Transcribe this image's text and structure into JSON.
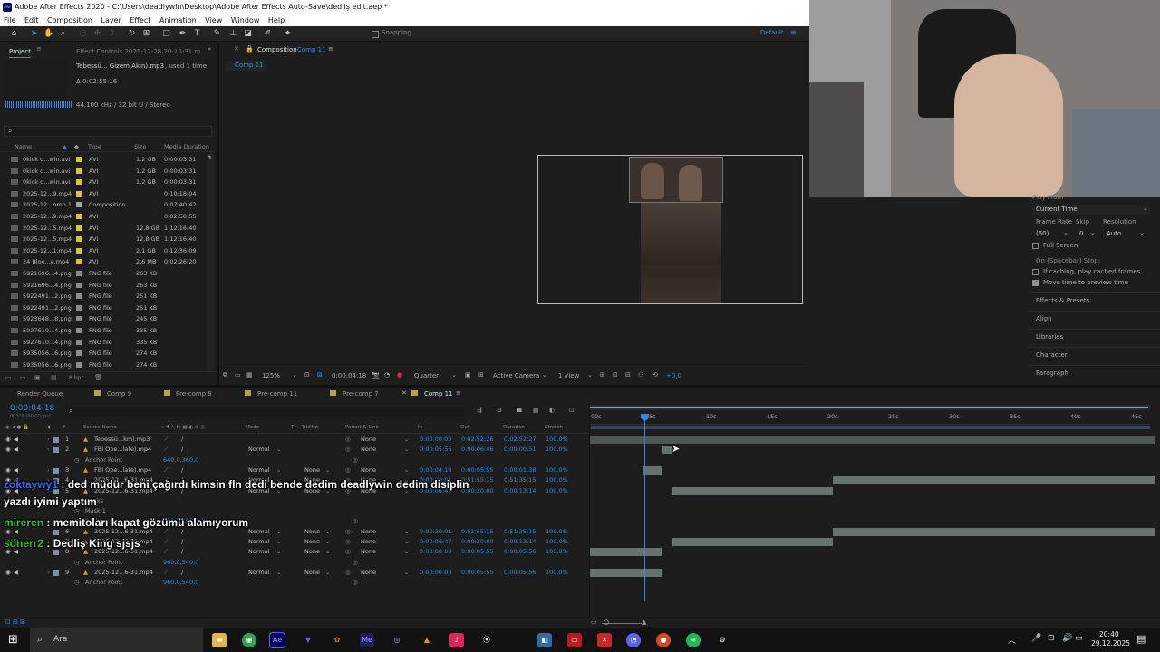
{
  "window": {
    "title": "Adobe After Effects 2020 - C:\\Users\\deadlywin\\Desktop\\Adobe After Effects Auto-Save\\dedliş edit.aep *",
    "logo": "Ae"
  },
  "menu": [
    "File",
    "Edit",
    "Composition",
    "Layer",
    "Effect",
    "Animation",
    "View",
    "Window",
    "Help"
  ],
  "toolbar": {
    "snapping": "Snapping",
    "workspace": "Default"
  },
  "project": {
    "tab": "Project",
    "effect_controls_tab": "Effect Controls 2025-12-28 20-16-31.m",
    "selected_name": "Tebessü... Gizem Akın).mp3",
    "used": ", used 1 time",
    "duration": "Δ 0:02:55:16",
    "audio_info": "44,100 kHz / 32 bit U / Stereo",
    "columns": {
      "name": "Name",
      "type": "Type",
      "size": "Size",
      "duration": "Media Duration"
    },
    "items": [
      {
        "name": "0kick d...win.avi",
        "type": "AVI",
        "size": "1,2 GB",
        "duration": "0:00:03:31",
        "color": "#d7c63a"
      },
      {
        "name": "0kick d...win.avi",
        "type": "AVI",
        "size": "1,2 GB",
        "duration": "0:00:03:31",
        "color": "#d7c63a"
      },
      {
        "name": "0kick d...win.avi",
        "type": "AVI",
        "size": "1,2 GB",
        "duration": "0:00:03:31",
        "color": "#d7c63a"
      },
      {
        "name": "2025-12...9.mp4",
        "type": "AVI",
        "size": "",
        "duration": "0:10:18:04",
        "color": "#d7c63a"
      },
      {
        "name": "2025-12...omp 1",
        "type": "Composition",
        "size": "",
        "duration": "0:07:40:42",
        "color": "#a3a3a3"
      },
      {
        "name": "2025-12...9.mp4",
        "type": "AVI",
        "size": "",
        "duration": "0:02:58:55",
        "color": "#d7c63a"
      },
      {
        "name": "2025-12...5.mp4",
        "type": "AVI",
        "size": "12,8 GB",
        "duration": "1:12:16:40",
        "color": "#d7c63a"
      },
      {
        "name": "2025-12...5.mp4",
        "type": "AVI",
        "size": "12,8 GB",
        "duration": "1:12:16:40",
        "color": "#d7c63a"
      },
      {
        "name": "2025-12...1.mp4",
        "type": "AVI",
        "size": "2,1 GB",
        "duration": "0:12:36:09",
        "color": "#d7c63a"
      },
      {
        "name": "24 Bloo...e.mp4",
        "type": "AVI",
        "size": "2,6 MB",
        "duration": "0:02:26:20",
        "color": "#d7c63a"
      },
      {
        "name": "5921696...4.png",
        "type": "PNG file",
        "size": "263 KB",
        "duration": "",
        "color": "#8c8c8c"
      },
      {
        "name": "5921696...4.png",
        "type": "PNG file",
        "size": "263 KB",
        "duration": "",
        "color": "#8c8c8c"
      },
      {
        "name": "5922491...2.png",
        "type": "PNG file",
        "size": "251 KB",
        "duration": "",
        "color": "#8c8c8c"
      },
      {
        "name": "5922491...2.png",
        "type": "PNG file",
        "size": "251 KB",
        "duration": "",
        "color": "#8c8c8c"
      },
      {
        "name": "5923648...8.png",
        "type": "PNG file",
        "size": "245 KB",
        "duration": "",
        "color": "#8c8c8c"
      },
      {
        "name": "5927610...4.png",
        "type": "PNG file",
        "size": "335 KB",
        "duration": "",
        "color": "#8c8c8c"
      },
      {
        "name": "5927610...4.png",
        "type": "PNG file",
        "size": "335 KB",
        "duration": "",
        "color": "#8c8c8c"
      },
      {
        "name": "5935056...6.png",
        "type": "PNG file",
        "size": "274 KB",
        "duration": "",
        "color": "#8c8c8c"
      },
      {
        "name": "5935056...6.png",
        "type": "PNG file",
        "size": "274 KB",
        "duration": "",
        "color": "#8c8c8c"
      }
    ],
    "bpc": "8 bpc"
  },
  "composition": {
    "tab_prefix": "Composition",
    "tab_name": "Comp 11",
    "breadcrumb": "Comp 11",
    "zoom": "125%",
    "timecode": "0:00:04:18",
    "resolution": "Quarter",
    "camera": "Active Camera",
    "view": "1 View",
    "exposure": "+0,0"
  },
  "preview": {
    "title": "Play From",
    "play_from": "Current Time",
    "frame_rate_label": "Frame Rate",
    "skip_label": "Skip",
    "resolution_label": "Resolution",
    "frame_rate": "(60)",
    "skip": "0",
    "resolution": "Auto",
    "full_screen": "Full Screen",
    "spacebar_stop": "On (Spacebar) Stop:",
    "cached": "If caching, play cached frames",
    "move_time": "Move time to preview time",
    "panels": [
      "Effects & Presets",
      "Align",
      "Libraries",
      "Character",
      "Paragraph"
    ]
  },
  "timeline": {
    "tabs": [
      "Render Queue",
      "Comp 9",
      "Pre-comp 8",
      "Pre-comp 11",
      "Pre-comp 7",
      "Comp 11"
    ],
    "timecode": "0:00:04:18",
    "timecode_sub": "00318 (60.00 fps)",
    "columns": {
      "source": "Source Name",
      "mode": "Mode",
      "t": "T",
      "trkmat": "TrkMat",
      "parent": "Parent & Link",
      "in": "In",
      "out": "Out",
      "duration": "Duration",
      "stretch": "Stretch"
    },
    "ruler": [
      "00s",
      "05s",
      "10s",
      "15s",
      "20s",
      "25s",
      "30s",
      "35s",
      "40s",
      "45s"
    ],
    "rows": [
      {
        "num": "1",
        "name": "Tebessü...km).mp3",
        "mode": "",
        "trk": "",
        "parent": "None",
        "in": "0:00:00:00",
        "out": "0:02:52:26",
        "dur": "0:02:52:27",
        "stretch": "100,0%"
      },
      {
        "num": "2",
        "name": "FBI Ope...late).mp4",
        "mode": "Normal",
        "trk": "",
        "parent": "None",
        "in": "0:00:05:56",
        "out": "0:00:06:46",
        "dur": "0:00:00:51",
        "stretch": "100,0%"
      },
      {
        "sub": "Anchor Point",
        "value": "640,0,360,0"
      },
      {
        "num": "3",
        "name": "FBI Ope...late).mp4",
        "mode": "Normal",
        "trk": "None",
        "parent": "None",
        "in": "0:00:04:18",
        "out": "0:00:05:55",
        "dur": "0:00:01:38",
        "stretch": "100,0%"
      },
      {
        "num": "4",
        "name": "2025-12...6-31.mp4",
        "mode": "Normal",
        "trk": "None",
        "parent": "None",
        "in": "0:00:20:01",
        "out": "0:51:55:15",
        "dur": "0:51:35:15",
        "stretch": "100,0%"
      },
      {
        "num": "5",
        "name": "2025-12...6-31.mp4",
        "mode": "Normal",
        "trk": "None",
        "parent": "None",
        "in": "0:00:06:47",
        "out": "0:00:20:00",
        "dur": "0:00:13:14",
        "stretch": "100,0%"
      },
      {
        "sub": "Masks",
        "value": ""
      },
      {
        "sub": "Mask 1",
        "value": ""
      },
      {
        "sub": "Scale",
        "value": "190,0,190,0 %"
      },
      {
        "num": "6",
        "name": "2025-12...6-31.mp4",
        "mode": "Normal",
        "trk": "None",
        "parent": "None",
        "in": "0:00:20:01",
        "out": "0:51:55:15",
        "dur": "0:51:35:15",
        "stretch": "100,0%"
      },
      {
        "num": "7",
        "name": "2025-12...6-31.mp4",
        "mode": "Normal",
        "trk": "None",
        "parent": "None",
        "in": "0:00:06:47",
        "out": "0:00:20:00",
        "dur": "0:00:13:14",
        "stretch": "100,0%"
      },
      {
        "num": "8",
        "name": "2025-12...6-31.mp4",
        "mode": "Normal",
        "trk": "None",
        "parent": "None",
        "in": "0:00:00:00",
        "out": "0:00:05:55",
        "dur": "0:00:05:56",
        "stretch": "100,0%"
      },
      {
        "sub": "Anchor Point",
        "value": "960,0,540,0"
      },
      {
        "num": "9",
        "name": "2025-12...6-31.mp4",
        "mode": "Normal",
        "trk": "None",
        "parent": "None",
        "in": "0:00:00:00",
        "out": "0:00:05:55",
        "dur": "0:00:05:56",
        "stretch": "100,0%"
      },
      {
        "sub": "Anchor Point",
        "value": "960,0,540,0"
      }
    ]
  },
  "chat": [
    {
      "user": "zoktaywy1",
      "sep": " : ",
      "text": "ded müdür beni çağırdı kimsin fln dedi bende dedim deadlywin dedim disiplin",
      "user_color": "#2f6fe0"
    },
    {
      "user": "",
      "sep": "",
      "text": "yazdı iyimi yaptım",
      "user_color": "#ffffff"
    },
    {
      "user": "mireren",
      "sep": " : ",
      "text": "memitoları kapat gözümü alamıyorum",
      "user_color": "#22c322"
    },
    {
      "user": "sönerr2",
      "sep": " : ",
      "text": "Dedliş King sjsjs",
      "user_color": "#22c322"
    }
  ],
  "taskbar": {
    "search": "Ara",
    "time": "20:40",
    "date": "29.12.2025"
  }
}
